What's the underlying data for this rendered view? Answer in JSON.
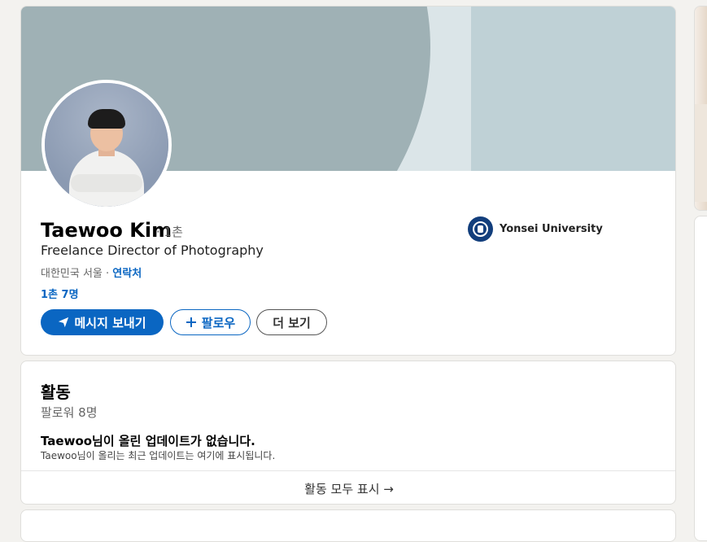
{
  "profile": {
    "name": "Taewoo Kim",
    "degree": "· 1촌",
    "headline": "Freelance Director of Photography",
    "location": "대한민국 서울 · ",
    "contact_label": "연락처",
    "connections": "1촌 7명",
    "school": "Yonsei University"
  },
  "actions": {
    "message": "메시지 보내기",
    "follow": "팔로우",
    "more": "더 보기"
  },
  "activity": {
    "title": "활동",
    "followers": "팔로워 8명",
    "empty_title": "Taewoo님이 올린 업데이트가 없습니다.",
    "empty_sub": "Taewoo님이 올리는 최근 업데이트는 여기에 표시됩니다.",
    "show_all": "활동 모두 표시 →"
  },
  "icons": [
    "send-icon",
    "plus-icon",
    "school-logo-icon"
  ],
  "colors": {
    "accent": "#0a66c2",
    "background": "#f3f2ef"
  }
}
